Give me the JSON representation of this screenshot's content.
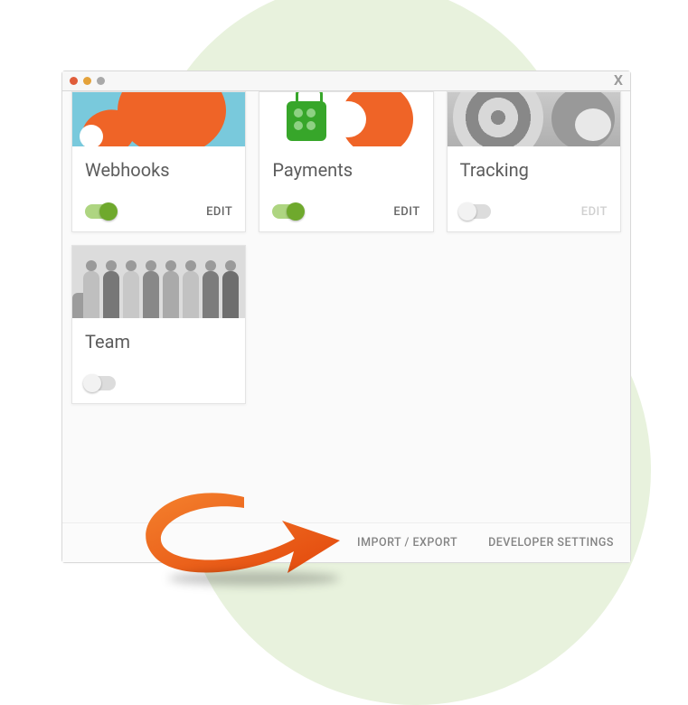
{
  "window": {
    "close_label": "X"
  },
  "cards": {
    "webhooks": {
      "title": "Webhooks",
      "edit": "EDIT",
      "enabled": true
    },
    "payments": {
      "title": "Payments",
      "edit": "EDIT",
      "enabled": true
    },
    "tracking": {
      "title": "Tracking",
      "edit": "EDIT",
      "enabled": false
    },
    "team": {
      "title": "Team",
      "edit": "",
      "enabled": false
    }
  },
  "footer": {
    "import_export": "IMPORT / EXPORT",
    "developer_settings": "DEVELOPER SETTINGS"
  },
  "colors": {
    "accent_orange": "#ef6427",
    "toggle_on": "#6fa92d",
    "toggle_track_on": "#aed581"
  }
}
